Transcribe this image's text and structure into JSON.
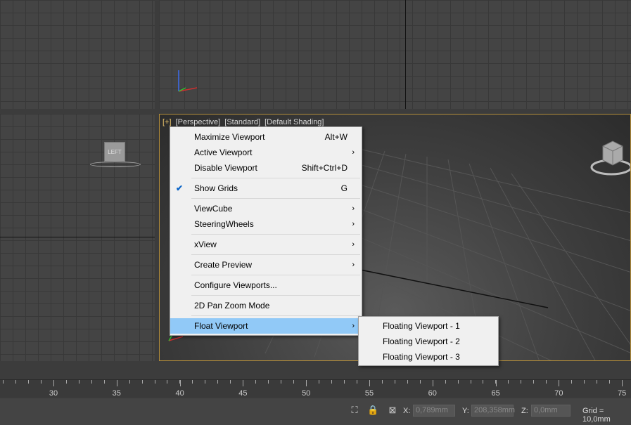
{
  "viewport": {
    "labels": [
      "[+]",
      "[Perspective]",
      "[Standard]",
      "[Default Shading]"
    ]
  },
  "viewcube_left": "LEFT",
  "context_menu": {
    "items": [
      {
        "label": "Maximize Viewport",
        "shortcut": "Alt+W",
        "submenu": false
      },
      {
        "label": "Active Viewport",
        "shortcut": "",
        "submenu": true
      },
      {
        "label": "Disable Viewport",
        "shortcut": "Shift+Ctrl+D",
        "submenu": false
      },
      {
        "label": "Show Grids",
        "shortcut": "G",
        "submenu": false,
        "checked": true
      },
      {
        "label": "ViewCube",
        "shortcut": "",
        "submenu": true
      },
      {
        "label": "SteeringWheels",
        "shortcut": "",
        "submenu": true
      },
      {
        "label": "xView",
        "shortcut": "",
        "submenu": true
      },
      {
        "label": "Create Preview",
        "shortcut": "",
        "submenu": true
      },
      {
        "label": "Configure Viewports...",
        "shortcut": "",
        "submenu": false
      },
      {
        "label": "2D Pan Zoom Mode",
        "shortcut": "",
        "submenu": false
      },
      {
        "label": "Float Viewport",
        "shortcut": "",
        "submenu": true,
        "highlighted": true
      }
    ],
    "arrow_glyph": "›",
    "check_glyph": "✔"
  },
  "submenu": {
    "items": [
      "Floating Viewport - 1",
      "Floating Viewport - 2",
      "Floating Viewport - 3"
    ]
  },
  "timeline": {
    "ticks": [
      "30",
      "35",
      "40",
      "45",
      "50",
      "55",
      "60",
      "65",
      "70",
      "75"
    ]
  },
  "status": {
    "x_label": "X:",
    "x_value": "0,789mm",
    "y_label": "Y:",
    "y_value": "208,358mm",
    "z_label": "Z:",
    "z_value": "0,0mm",
    "grid": "Grid = 10,0mm",
    "icons": [
      "selection-icon",
      "lock-icon",
      "absolute-mode-icon"
    ]
  },
  "colors": {
    "active_border": "#b38d3a",
    "highlight": "#91c9f7",
    "check": "#0a64c8"
  }
}
